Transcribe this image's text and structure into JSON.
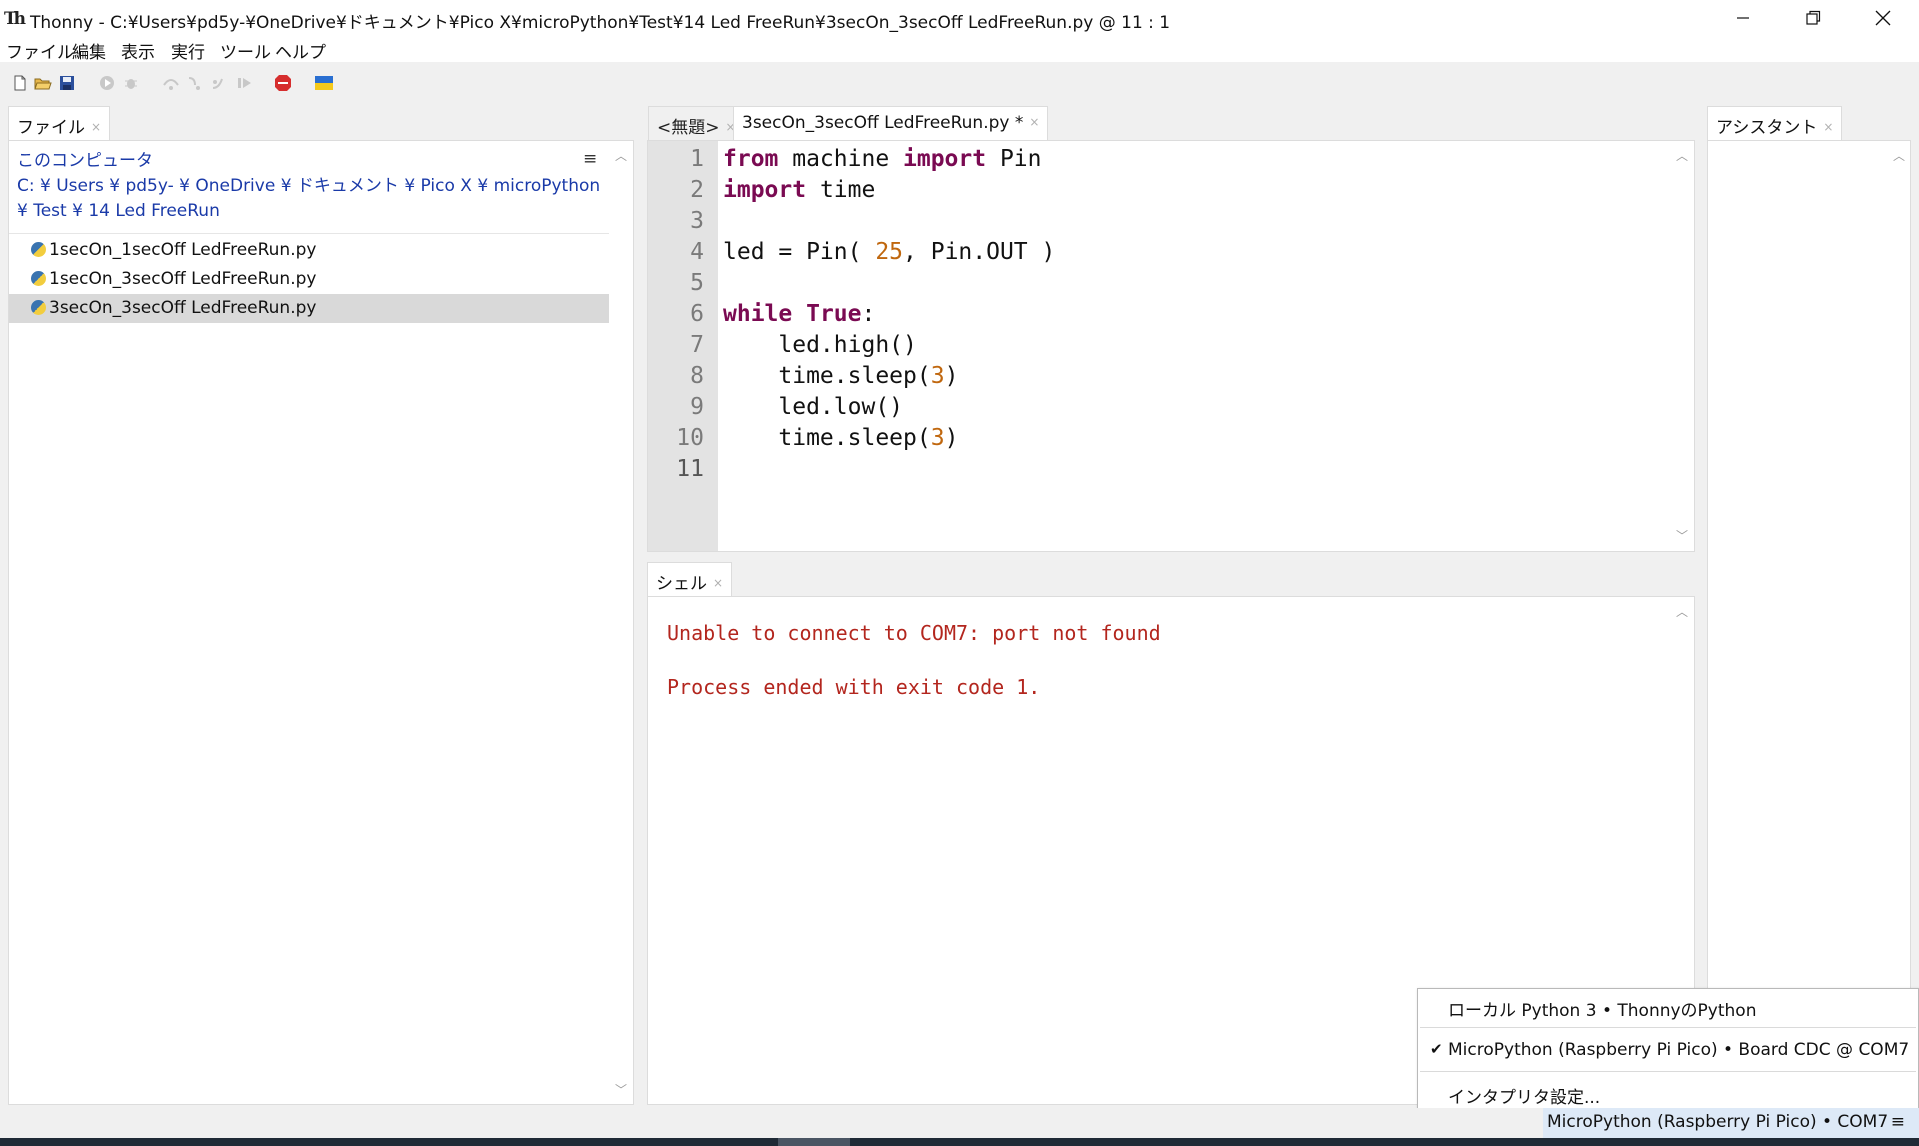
{
  "window": {
    "title": "Thonny  -  C:¥Users¥pd5y-¥OneDrive¥ドキュメント¥Pico X¥microPython¥Test¥14 Led FreeRun¥3secOn_3secOff LedFreeRun.py  @  11 : 1",
    "app_icon": "Th"
  },
  "menu": [
    "ファイル",
    "編集",
    "表示",
    "実行",
    "ツール",
    "ヘルプ"
  ],
  "toolbar_icons": [
    "new-file-icon",
    "open-folder-icon",
    "save-icon",
    "run-icon",
    "debug-icon",
    "step-over-icon",
    "step-into-icon",
    "step-out-icon",
    "resume-icon",
    "stop-icon",
    "ukraine-flag-icon"
  ],
  "files": {
    "tab_label": "ファイル",
    "location_label": "このコンピュータ",
    "path": "C: ¥ Users ¥ pd5y- ¥ OneDrive ¥ ドキュメント ¥ Pico X ¥ microPython ¥ Test ¥ 14 Led FreeRun",
    "items": [
      {
        "name": "1secOn_1secOff LedFreeRun.py",
        "selected": false
      },
      {
        "name": "1secOn_3secOff LedFreeRun.py",
        "selected": false
      },
      {
        "name": "3secOn_3secOff LedFreeRun.py",
        "selected": true
      }
    ]
  },
  "editor": {
    "tabs": [
      {
        "label": "<無題>",
        "active": false
      },
      {
        "label": "3secOn_3secOff LedFreeRun.py *",
        "active": true
      }
    ],
    "line_numbers": [
      "1",
      "2",
      "3",
      "4",
      "5",
      "6",
      "7",
      "8",
      "9",
      "10",
      "11"
    ]
  },
  "shell": {
    "tab_label": "シェル",
    "lines": [
      "Unable to connect to COM7: port not found",
      "Process ended with exit code 1."
    ]
  },
  "assistant": {
    "tab_label": "アシスタント"
  },
  "interpreter_menu": {
    "options": [
      {
        "label": "ローカル Python 3  •  ThonnyのPython",
        "checked": false
      },
      {
        "label": "MicroPython (Raspberry Pi Pico)  •  Board CDC @ COM7",
        "checked": true
      },
      {
        "label": "インタプリタ設定...",
        "checked": false
      }
    ]
  },
  "statusbar": {
    "interpreter": "MicroPython (Raspberry Pi Pico)  •  COM7",
    "menu_glyph": "≡"
  },
  "colors": {
    "keyword": "#7a0a52",
    "number": "#c0670e",
    "error": "#b3261e",
    "path": "#1a3aa8"
  }
}
